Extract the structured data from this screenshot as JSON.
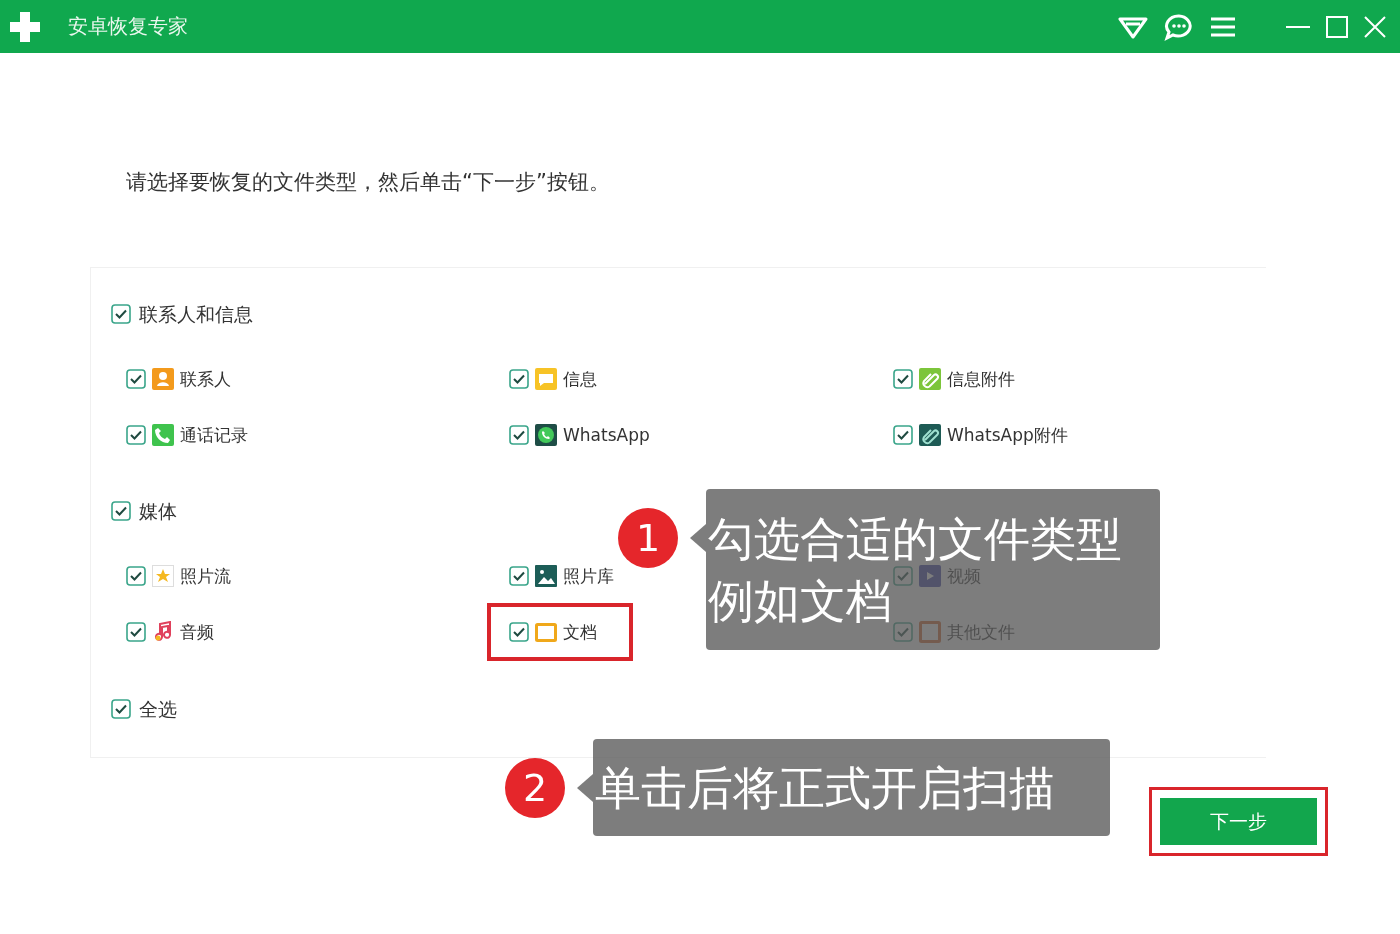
{
  "window": {
    "title": "安卓恢复专家"
  },
  "instruction": "请选择要恢复的文件类型，然后单击“下一步”按钮。",
  "groups": [
    {
      "label": "联系人和信息",
      "checked": true,
      "items": [
        {
          "label": "联系人",
          "checked": true,
          "kind": "contact",
          "highlighted": false
        },
        {
          "label": "信息",
          "checked": true,
          "kind": "message",
          "highlighted": false
        },
        {
          "label": "信息附件",
          "checked": true,
          "kind": "attachment",
          "highlighted": false
        },
        {
          "label": "通话记录",
          "checked": true,
          "kind": "phone",
          "highlighted": false
        },
        {
          "label": "WhatsApp",
          "checked": true,
          "kind": "whatsapp",
          "highlighted": false
        },
        {
          "label": "WhatsApp附件",
          "checked": true,
          "kind": "whatsapp_attachment",
          "highlighted": false
        }
      ]
    },
    {
      "label": "媒体",
      "checked": true,
      "items": [
        {
          "label": "照片流",
          "checked": true,
          "kind": "photostream",
          "highlighted": false
        },
        {
          "label": "照片库",
          "checked": true,
          "kind": "gallery",
          "highlighted": false
        },
        {
          "label": "视频",
          "checked": true,
          "kind": "video",
          "highlighted": false
        },
        {
          "label": "音频",
          "checked": true,
          "kind": "audio",
          "highlighted": false
        },
        {
          "label": "文档",
          "checked": true,
          "kind": "document",
          "highlighted": true
        },
        {
          "label": "其他文件",
          "checked": true,
          "kind": "other",
          "highlighted": false
        }
      ]
    }
  ],
  "select_all": {
    "label": "全选",
    "checked": true
  },
  "next_button": {
    "label": "下一步",
    "highlighted": true
  },
  "annotations": [
    {
      "number": "1",
      "lines": [
        "勾选合适的文件类型",
        "例如文档"
      ]
    },
    {
      "number": "2",
      "lines": [
        "单击后将正式开启扫描"
      ]
    }
  ]
}
